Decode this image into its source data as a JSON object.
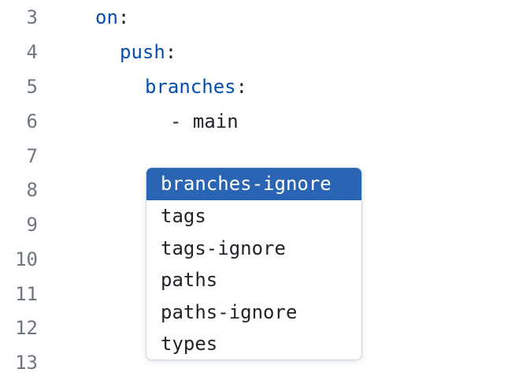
{
  "editor": {
    "lines": [
      {
        "number": "3",
        "tokens": [
          {
            "text": "on",
            "kind": "key"
          },
          {
            "text": ":",
            "kind": "punct"
          }
        ]
      },
      {
        "number": "4",
        "tokens": [
          {
            "text": "push",
            "kind": "key"
          },
          {
            "text": ":",
            "kind": "punct"
          }
        ]
      },
      {
        "number": "5",
        "tokens": [
          {
            "text": "branches",
            "kind": "key"
          },
          {
            "text": ":",
            "kind": "punct"
          }
        ]
      },
      {
        "number": "6",
        "tokens": [
          {
            "text": "- main",
            "kind": "plain"
          }
        ]
      },
      {
        "number": "7",
        "tokens": []
      },
      {
        "number": "8",
        "tokens": []
      },
      {
        "number": "9",
        "tokens": []
      },
      {
        "number": "10",
        "tokens": []
      },
      {
        "number": "11",
        "tokens": []
      },
      {
        "number": "12",
        "tokens": []
      },
      {
        "number": "13",
        "tokens": []
      }
    ]
  },
  "autocomplete": {
    "selected_index": 0,
    "items": [
      "branches-ignore",
      "tags",
      "tags-ignore",
      "paths",
      "paths-ignore",
      "types"
    ]
  },
  "colors": {
    "key": "#0550ae",
    "line_number": "#6e7781",
    "selection": "#2a64b4"
  }
}
